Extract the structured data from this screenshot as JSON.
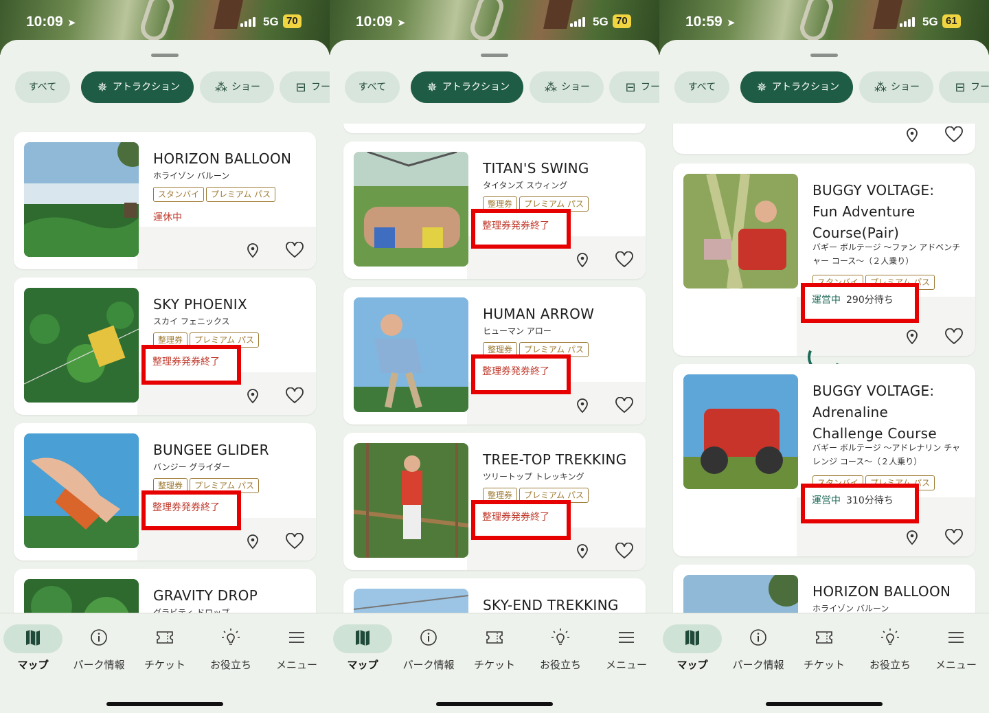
{
  "colors": {
    "accent": "#1f5c45",
    "status_closed": "#c0392b",
    "status_running": "#1f6b59",
    "tag_gold": "#9d7a33",
    "highlight_red": "#e60000"
  },
  "filters": [
    {
      "label": "すべて",
      "icon": ""
    },
    {
      "label": "アトラクション",
      "icon": "attraction-icon"
    },
    {
      "label": "ショー",
      "icon": "show-icon"
    },
    {
      "label": "フー",
      "icon": "food-icon"
    }
  ],
  "tabs": [
    {
      "label": "マップ",
      "icon": "map-icon"
    },
    {
      "label": "パーク情報",
      "icon": "info-icon"
    },
    {
      "label": "チケット",
      "icon": "ticket-icon"
    },
    {
      "label": "お役立ち",
      "icon": "lightbulb-icon"
    },
    {
      "label": "メニュー",
      "icon": "menu-icon"
    }
  ],
  "screens": [
    {
      "time": "10:09",
      "network": "5G",
      "battery": "70",
      "cards": [
        {
          "title": "HORIZON BALLOON",
          "subtitle": "ホライゾン バルーン",
          "tags": [
            "スタンバイ",
            "プレミアム パス"
          ],
          "status": "運休中"
        },
        {
          "title": "SKY PHOENIX",
          "subtitle": "スカイ フェニックス",
          "tags": [
            "整理券",
            "プレミアム パス"
          ],
          "status": "整理券発券終了"
        },
        {
          "title": "BUNGEE GLIDER",
          "subtitle": "バンジー グライダー",
          "tags": [
            "整理券",
            "プレミアム パス"
          ],
          "status": "整理券発券終了"
        },
        {
          "title": "GRAVITY DROP",
          "subtitle": "グラビティ ドロップ"
        }
      ]
    },
    {
      "time": "10:09",
      "network": "5G",
      "battery": "70",
      "cards": [
        {
          "title": "TITAN'S SWING",
          "subtitle": "タイタンズ スウィング",
          "tags": [
            "整理券",
            "プレミアム パス"
          ],
          "status": "整理券発券終了"
        },
        {
          "title": "HUMAN ARROW",
          "subtitle": "ヒューマン アロー",
          "tags": [
            "整理券",
            "プレミアム パス"
          ],
          "status": "整理券発券終了"
        },
        {
          "title": "TREE-TOP TREKKING",
          "subtitle": "ツリートップ トレッキング",
          "tags": [
            "整理券",
            "プレミアム パス"
          ],
          "status": "整理券発券終了"
        },
        {
          "title": "SKY-END TREKKING"
        }
      ]
    },
    {
      "time": "10:59",
      "network": "5G",
      "battery": "61",
      "cards": [
        {
          "title": "BUGGY VOLTAGE: Fun Adventure Course(Pair)",
          "subtitle": "バギー ボルテージ ～ファン アドベンチャー コース～（２人乗り）",
          "tags": [
            "スタンバイ",
            "プレミアム パス"
          ],
          "status": "運営中",
          "wait": "290分待ち"
        },
        {
          "title": "BUGGY VOLTAGE: Adrenaline Challenge Course",
          "subtitle": "バギー ボルテージ ～アドレナリン チャレンジ コース～（２人乗り）",
          "tags": [
            "スタンバイ",
            "プレミアム パス"
          ],
          "status": "運営中",
          "wait": "310分待ち"
        },
        {
          "title": "HORIZON BALLOON",
          "subtitle": "ホライゾン バルーン"
        }
      ]
    }
  ]
}
